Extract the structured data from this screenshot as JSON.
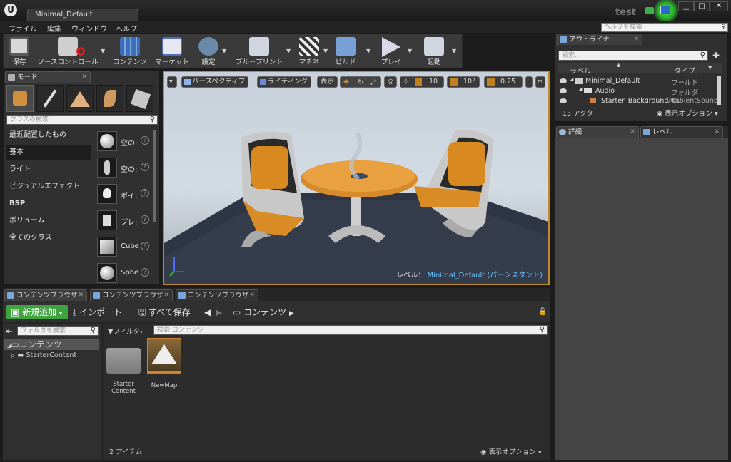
{
  "titlebar": {
    "logo": "U",
    "document_tab": "Minimal_Default",
    "project_name": "test",
    "window_buttons": [
      "▁",
      "□",
      "✕"
    ]
  },
  "menubar": {
    "items": [
      "ファイル",
      "編集",
      "ウィンドウ",
      "ヘルプ"
    ],
    "help_search_placeholder": "ヘルプを検索"
  },
  "toolbar": {
    "items": [
      {
        "label": "保存",
        "icon": "save-icon"
      },
      {
        "label": "ソースコントロール",
        "icon": "source-control-icon"
      },
      {
        "label": "コンテンツ",
        "icon": "content-icon"
      },
      {
        "label": "マーケット",
        "icon": "marketplace-icon"
      },
      {
        "label": "設定",
        "icon": "settings-icon"
      },
      {
        "label": "ブループリント",
        "icon": "blueprint-icon"
      },
      {
        "label": "マチネ",
        "icon": "matinee-icon"
      },
      {
        "label": "ビルド",
        "icon": "build-icon"
      },
      {
        "label": "プレイ",
        "icon": "play-icon"
      },
      {
        "label": "起動",
        "icon": "launch-icon"
      }
    ]
  },
  "modes": {
    "tab": "モード",
    "search_placeholder": "クラスの検索",
    "categories": [
      "最近配置したもの",
      "基本",
      "ライト",
      "ビジュアルエフェクト",
      "BSP",
      "ボリューム",
      "全てのクラス"
    ],
    "selected_category": "基本",
    "items": [
      "空の:",
      "空の:",
      "ポイ:",
      "プレ:",
      "Cube",
      "Sphe"
    ]
  },
  "viewport": {
    "buttons": [
      "パースペクティブ",
      "ライティング",
      "表示"
    ],
    "grid_snap": "10",
    "rotation_snap": "10°",
    "scale_snap": "0.25",
    "level_prefix": "レベル：",
    "level_name": "Minimal_Default (パーシスタント)"
  },
  "outliner": {
    "tab": "アウトライナ",
    "search_placeholder": "検索...",
    "col_label": "ラベル",
    "col_type": "タイプ",
    "rows": [
      {
        "label": "Minimal_Default",
        "type": "ワールド"
      },
      {
        "label": "Audio",
        "type": "フォルダ"
      },
      {
        "label": "Starter_Background_Cu",
        "type": "AmbientSound"
      }
    ],
    "actor_count": "13 アクタ",
    "view_options": "表示オプション"
  },
  "details": {
    "tab_details": "詳細",
    "tab_levels": "レベル"
  },
  "content_browser": {
    "tabs": [
      "コンテンツブラウザ",
      "コンテンツブラウザ",
      "コンテンツブラウザ"
    ],
    "new_button": "新規追加",
    "import_button": "インポート",
    "save_all_button": "すべて保存",
    "path_root": "コンテンツ",
    "folder_search_placeholder": "フォルダを検索",
    "tree_root": "コンテンツ",
    "tree_child": "StarterContent",
    "filter_button": "フィルタ",
    "asset_search_placeholder": "検索 コンテンツ",
    "assets": [
      {
        "name": "Starter Content"
      },
      {
        "name": "NewMap"
      }
    ],
    "item_count": "2 アイテム",
    "view_options": "表示オプション"
  }
}
